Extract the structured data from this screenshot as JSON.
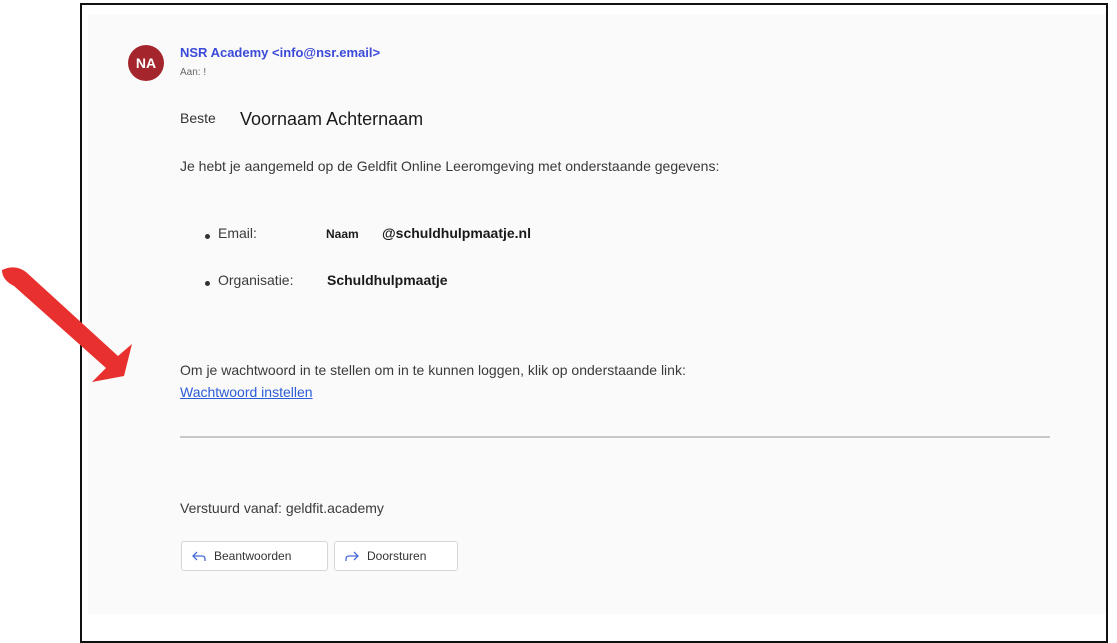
{
  "email": {
    "sender_initials": "NA",
    "sender": "NSR Academy <info@nsr.email>",
    "to": "Aan: !",
    "greeting": "Beste",
    "recipient_name": "Voornaam Achternaam",
    "intro": "Je hebt je aangemeld op de Geldfit Online Leeromgeving met onderstaande gegevens:",
    "details": {
      "email_label": "Email:",
      "email_name": "Naam",
      "email_domain": "@schuldhulpmaatje.nl",
      "org_label": "Organisatie:",
      "org_value": "Schuldhulpmaatje"
    },
    "instruction": "Om je wachtwoord in te stellen om in te kunnen loggen, klik op onderstaande link:",
    "link_text": "Wachtwoord instellen",
    "footer": "Verstuurd vanaf: geldfit.academy"
  },
  "actions": {
    "reply_label": "Beantwoorden",
    "forward_label": "Doorsturen"
  },
  "colors": {
    "avatar": "#a4262c",
    "sender": "#3b4ad8",
    "link": "#2b5cd6",
    "arrow": "#e8312f"
  }
}
